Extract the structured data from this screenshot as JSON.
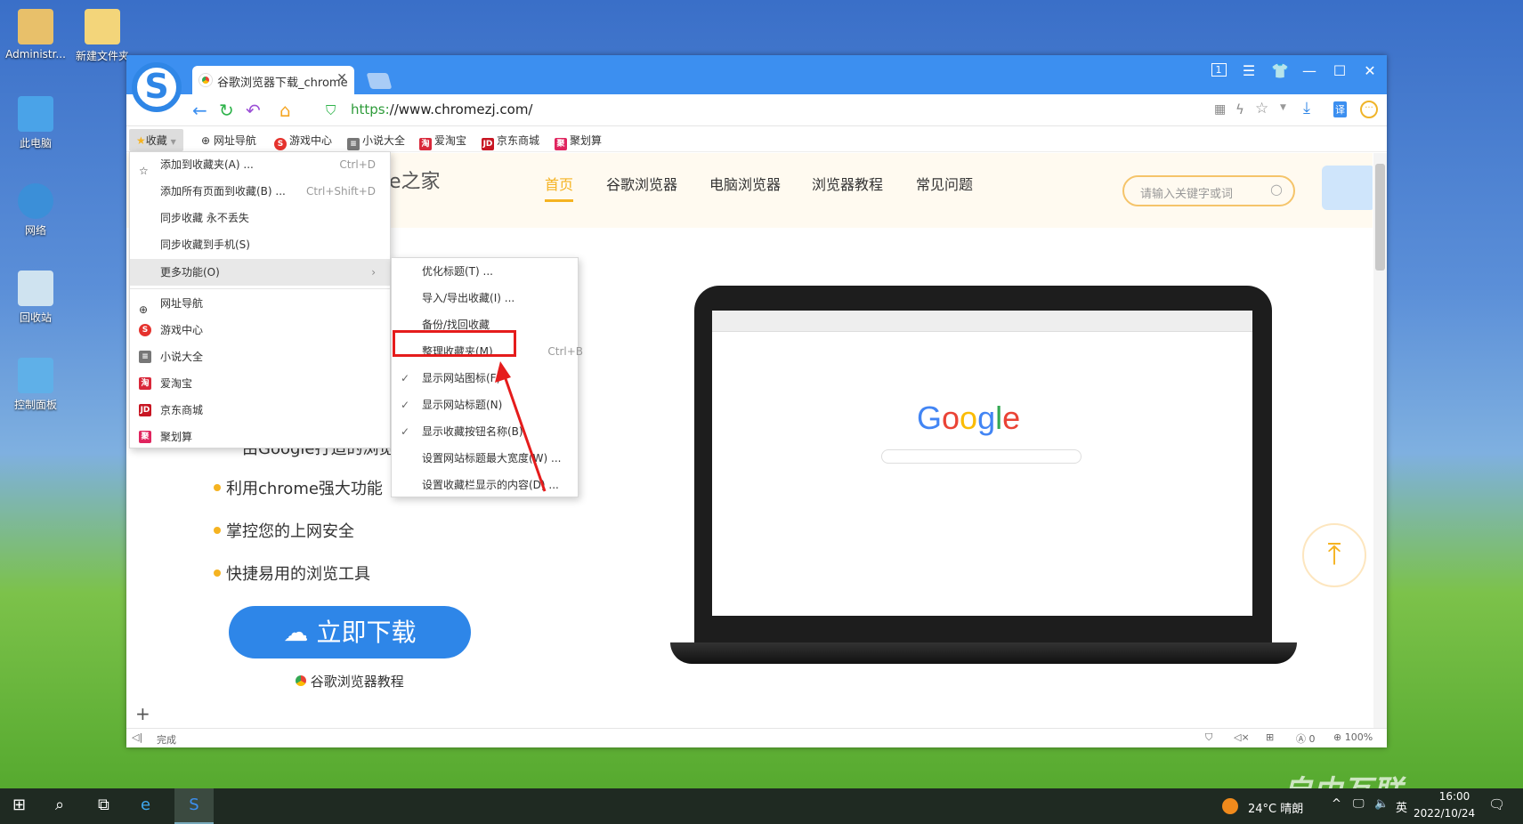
{
  "desktop": {
    "icons": [
      {
        "label": "Administr..."
      },
      {
        "label": "新建文件夹"
      },
      {
        "label": "此电脑"
      },
      {
        "label": "网络"
      },
      {
        "label": "回收站"
      },
      {
        "label": "控制面板"
      }
    ]
  },
  "browser": {
    "tab_title": "谷歌浏览器下载_chrome",
    "url_scheme": "https:",
    "url_rest": "//www.chromezj.com/",
    "window_controls": [
      "tab-count-1",
      "menu",
      "skin",
      "minimize",
      "maximize",
      "close"
    ],
    "tab_count": "1",
    "bookmarks": [
      {
        "label": "收藏",
        "icon": "star-icon"
      },
      {
        "label": "网址导航",
        "icon": "globe-icon"
      },
      {
        "label": "游戏中心",
        "icon": "game-icon"
      },
      {
        "label": "小说大全",
        "icon": "book-icon"
      },
      {
        "label": "爱淘宝",
        "icon": "taobao-icon",
        "badge": "淘"
      },
      {
        "label": "京东商城",
        "icon": "jd-icon",
        "badge": "JD"
      },
      {
        "label": "聚划算",
        "icon": "juhuasuan-icon",
        "badge": "聚"
      }
    ],
    "favorites_menu": [
      {
        "label": "添加到收藏夹(A) ...",
        "shortcut": "Ctrl+D"
      },
      {
        "label": "添加所有页面到收藏(B) ...",
        "shortcut": "Ctrl+Shift+D"
      },
      {
        "label": "同步收藏 永不丢失"
      },
      {
        "label": "同步收藏到手机(S)"
      },
      {
        "label": "更多功能(O)"
      },
      {
        "label": "网址导航"
      },
      {
        "label": "游戏中心"
      },
      {
        "label": "小说大全"
      },
      {
        "label": "爱淘宝"
      },
      {
        "label": "京东商城"
      },
      {
        "label": "聚划算"
      }
    ],
    "submenu": [
      {
        "label": "优化标题(T) ..."
      },
      {
        "label": "导入/导出收藏(I) ..."
      },
      {
        "label": "备份/找回收藏"
      },
      {
        "label": "整理收藏夹(M)",
        "shortcut": "Ctrl+B",
        "highlighted": true
      },
      {
        "label": "显示网站图标(F)",
        "checked": true
      },
      {
        "label": "显示网站标题(N)",
        "checked": true
      },
      {
        "label": "显示收藏按钮名称(B)",
        "checked": true
      },
      {
        "label": "设置网站标题最大宽度(W) ..."
      },
      {
        "label": "设置收藏栏显示的内容(D) ..."
      }
    ],
    "status": {
      "text": "完成",
      "ad_count": "0",
      "zoom": "100%"
    }
  },
  "site": {
    "logo_text": "e之家",
    "nav": [
      "首页",
      "谷歌浏览器",
      "电脑浏览器",
      "浏览器教程",
      "常见问题"
    ],
    "active_nav": "首页",
    "search_placeholder": "请输入关键字或词",
    "partial_line": "由Google打造的浏览",
    "bullets": [
      "利用chrome强大功能",
      "掌控您的上网安全",
      "快捷易用的浏览工具"
    ],
    "download_label": "立即下载",
    "tutorial_link": "谷歌浏览器教程",
    "screen_logo": "Google",
    "accent": "#f5b321",
    "button_color": "#2e86e8"
  },
  "taskbar": {
    "weather": "24°C 晴朗",
    "ime": "英",
    "time": "16:00",
    "date": "2022/10/24"
  },
  "watermark": "自由互联"
}
